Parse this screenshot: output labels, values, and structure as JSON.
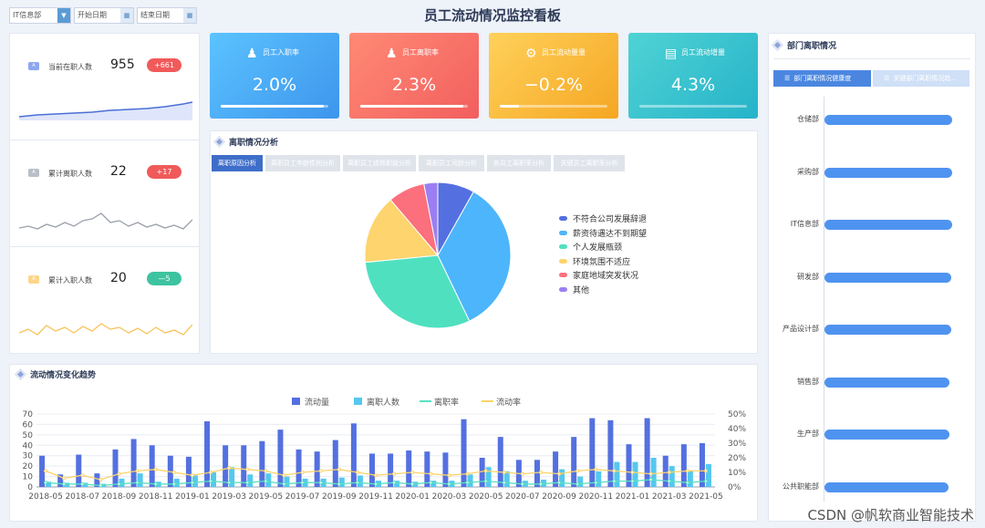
{
  "header": {
    "title": "员工流动情况监控看板"
  },
  "filters": {
    "department": "IT信息部",
    "start_date": "开始日期",
    "end_date": "结束日期"
  },
  "kpis": [
    {
      "label": "员工入职率",
      "value": "2.0%",
      "progress": 0.96,
      "color_from": "#5bc3ff",
      "color_to": "#3d95ec"
    },
    {
      "label": "员工离职率",
      "value": "2.3%",
      "progress": 0.96,
      "color_from": "#ff8a75",
      "color_to": "#f25f5e"
    },
    {
      "label": "员工流动量量",
      "value": "−0.2%",
      "progress": 0.18,
      "color_from": "#ffd15a",
      "color_to": "#f5a623"
    },
    {
      "label": "员工流动增量",
      "value": "4.3%",
      "progress": 0,
      "color_from": "#4fd3d4",
      "color_to": "#26b3c9"
    }
  ],
  "stats": [
    {
      "label": "当前在职人数",
      "value": "955",
      "badge": "+661",
      "badge_color": "#f05a5a",
      "chip_color": "#8ea6f0",
      "line_color": "#4b6fd6"
    },
    {
      "label": "累计离职人数",
      "value": "22",
      "badge": "+17",
      "badge_color": "#f05a5a",
      "chip_color": "#b9bfc9",
      "line_color": "#9aa0ab"
    },
    {
      "label": "累计入职人数",
      "value": "20",
      "badge": "—5",
      "badge_color": "#3dc3a0",
      "chip_color": "#fcd68a",
      "line_color": "#f8c35a"
    }
  ],
  "turnover": {
    "title": "离职情况分析",
    "tabs": [
      "离职原因分析",
      "离职员工年龄性别分析",
      "离职员工绩效职级分析",
      "离职员工司龄分析",
      "各员工离职率分析",
      "关键员工离职率分析"
    ]
  },
  "trend": {
    "title": "流动情况变化趋势"
  },
  "departments": {
    "title": "部门离职情况",
    "tabs": [
      "部门离职情况健康度",
      "关键部门离职情况趋..."
    ],
    "items": [
      {
        "name": "仓储部",
        "value": 0.96
      },
      {
        "name": "采购部",
        "value": 0.96
      },
      {
        "name": "IT信息部",
        "value": 0.96
      },
      {
        "name": "研发部",
        "value": 0.95
      },
      {
        "name": "产品设计部",
        "value": 0.95
      },
      {
        "name": "销售部",
        "value": 0.94
      },
      {
        "name": "生产部",
        "value": 0.94
      },
      {
        "name": "公共职能部",
        "value": 0.93
      }
    ]
  },
  "watermark": "CSDN @帆软商业智能技术",
  "chart_data": [
    {
      "type": "pie",
      "categories": [
        "不符合公司发展辞退",
        "薪资待遇达不到期望",
        "个人发展瓶颈",
        "环境氛围不适应",
        "家庭地域突发状况",
        "其他"
      ],
      "values": [
        8,
        34,
        30,
        15,
        8,
        3
      ],
      "colors": [
        "#5470e0",
        "#4db5fb",
        "#4fe0c0",
        "#fdd46d",
        "#fc6f7d",
        "#9b7ff2"
      ]
    },
    {
      "type": "bar",
      "categories": [
        "2018-05",
        "2018-06",
        "2018-07",
        "2018-08",
        "2018-09",
        "2018-10",
        "2018-11",
        "2018-12",
        "2019-01",
        "2019-02",
        "2019-03",
        "2019-04",
        "2019-05",
        "2019-06",
        "2019-07",
        "2019-08",
        "2019-09",
        "2019-10",
        "2019-11",
        "2019-12",
        "2020-01",
        "2020-02",
        "2020-03",
        "2020-04",
        "2020-05",
        "2020-06",
        "2020-07",
        "2020-08",
        "2020-09",
        "2020-10",
        "2020-11",
        "2020-12",
        "2021-01",
        "2021-02",
        "2021-03",
        "2021-04",
        "2021-05"
      ],
      "tick_labels": [
        "2018-05",
        "2018-07",
        "2018-09",
        "2018-11",
        "2019-01",
        "2019-03",
        "2019-05",
        "2019-07",
        "2019-09",
        "2019-11",
        "2020-01",
        "2020-03",
        "2020-05",
        "2020-07",
        "2020-09",
        "2020-11",
        "2021-01",
        "2021-03",
        "2021-05"
      ],
      "series": [
        {
          "name": "流动量",
          "kind": "bar",
          "axis": "left",
          "color": "#5470e0",
          "values": [
            30,
            12,
            31,
            13,
            36,
            46,
            40,
            30,
            29,
            63,
            40,
            40,
            44,
            55,
            36,
            34,
            45,
            61,
            32,
            32,
            35,
            34,
            33,
            65,
            28,
            48,
            26,
            26,
            34,
            48,
            66,
            64,
            41,
            66,
            30,
            41,
            42
          ]
        },
        {
          "name": "离职人数",
          "kind": "bar",
          "axis": "left",
          "color": "#54c8ef",
          "values": [
            5,
            4,
            4,
            3,
            8,
            13,
            5,
            8,
            11,
            14,
            19,
            12,
            13,
            10,
            8,
            8,
            9,
            11,
            6,
            6,
            5,
            6,
            6,
            12,
            19,
            15,
            6,
            7,
            17,
            10,
            15,
            24,
            24,
            28,
            20,
            16,
            22
          ]
        },
        {
          "name": "离职率",
          "kind": "line",
          "axis": "right",
          "color": "#5ae0c0",
          "values": [
            3,
            2,
            2,
            1,
            2,
            3,
            2,
            2,
            3,
            4,
            3,
            3,
            4,
            2,
            3,
            3,
            2,
            3,
            2,
            3,
            2,
            3,
            2,
            3,
            4,
            3,
            2,
            2,
            3,
            2,
            3,
            4,
            4,
            5,
            4,
            3,
            4
          ]
        },
        {
          "name": "流动率",
          "kind": "line",
          "axis": "right",
          "color": "#fbd36a",
          "values": [
            11,
            6,
            8,
            5,
            9,
            11,
            12,
            10,
            8,
            10,
            13,
            12,
            11,
            8,
            10,
            11,
            12,
            10,
            8,
            9,
            10,
            9,
            8,
            9,
            11,
            10,
            9,
            10,
            9,
            11,
            12,
            11,
            10,
            9,
            10,
            11,
            11
          ]
        }
      ],
      "ylim_left": [
        0,
        70
      ],
      "ylim_right": [
        0,
        50
      ],
      "yticks_left": [
        "0",
        "10",
        "20",
        "30",
        "40",
        "50",
        "60",
        "70"
      ],
      "yticks_right": [
        "0%",
        "10%",
        "20%",
        "30%",
        "40%",
        "50%"
      ],
      "legend": "top-center"
    }
  ]
}
